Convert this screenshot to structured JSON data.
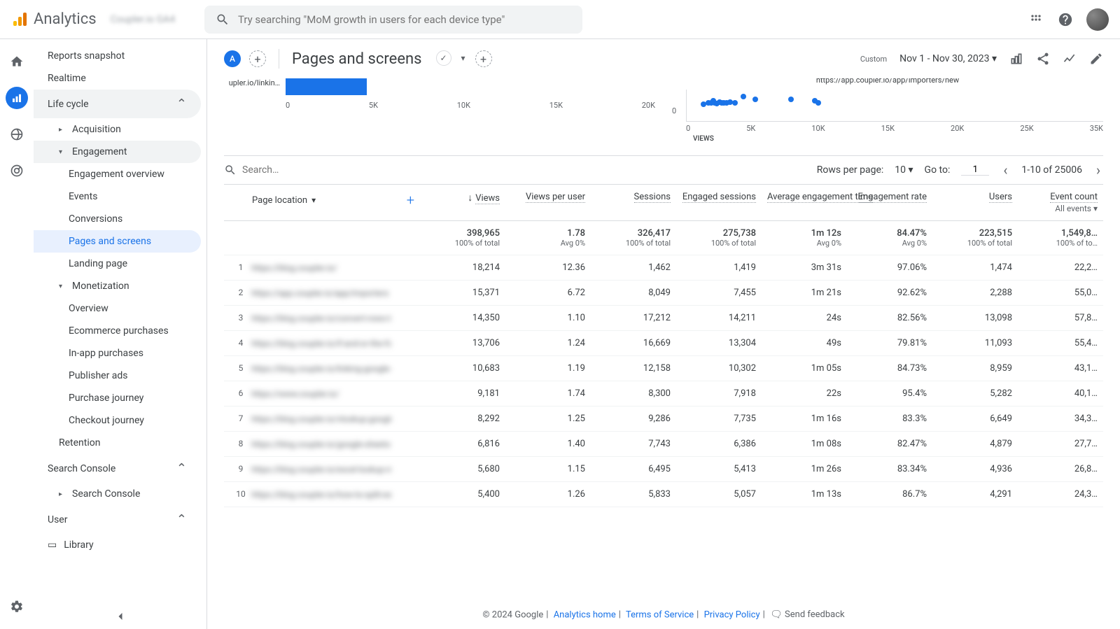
{
  "brand": "Analytics",
  "brand_sub": "Coupler.io GA4",
  "search_placeholder": "Try searching \"MoM growth in users for each device type\"",
  "nav": {
    "reports_snapshot": "Reports snapshot",
    "realtime": "Realtime",
    "life_cycle": "Life cycle",
    "acquisition": "Acquisition",
    "engagement": "Engagement",
    "engagement_overview": "Engagement overview",
    "events": "Events",
    "conversions": "Conversions",
    "pages_screens": "Pages and screens",
    "landing_page": "Landing page",
    "monetization": "Monetization",
    "mon_overview": "Overview",
    "ecommerce": "Ecommerce purchases",
    "inapp": "In-app purchases",
    "publisher": "Publisher ads",
    "purchase_journey": "Purchase journey",
    "checkout_journey": "Checkout journey",
    "retention": "Retention",
    "search_console": "Search Console",
    "search_console_sub": "Search Console",
    "user": "User",
    "library": "Library"
  },
  "page": {
    "badge": "A",
    "title": "Pages and screens",
    "date_label": "Custom",
    "date_range": "Nov 1 - Nov 30, 2023"
  },
  "chart_data": [
    {
      "type": "bar",
      "orientation": "horizontal",
      "categories": [
        "upler.io/linkin…"
      ],
      "values": [
        4400
      ],
      "xlim": [
        0,
        20000
      ],
      "xticks": [
        "0",
        "5K",
        "10K",
        "15K",
        "20K"
      ]
    },
    {
      "type": "scatter",
      "title": "https://app.coupler.io/app/importers/new",
      "xlim": [
        0,
        35000
      ],
      "ylim": [
        0,
        1
      ],
      "xlabel": "VIEWS",
      "xticks": [
        "0",
        "5K",
        "10K",
        "15K",
        "20K",
        "25K",
        "35K"
      ],
      "points": [
        {
          "x": 1200,
          "y": 0.45
        },
        {
          "x": 1600,
          "y": 0.5
        },
        {
          "x": 1800,
          "y": 0.48
        },
        {
          "x": 2000,
          "y": 0.55
        },
        {
          "x": 2100,
          "y": 0.5
        },
        {
          "x": 2300,
          "y": 0.46
        },
        {
          "x": 2500,
          "y": 0.52
        },
        {
          "x": 2700,
          "y": 0.5
        },
        {
          "x": 2900,
          "y": 0.48
        },
        {
          "x": 3100,
          "y": 0.5
        },
        {
          "x": 3400,
          "y": 0.52
        },
        {
          "x": 3800,
          "y": 0.5
        },
        {
          "x": 4500,
          "y": 0.7
        },
        {
          "x": 5500,
          "y": 0.6
        },
        {
          "x": 8500,
          "y": 0.6
        },
        {
          "x": 10500,
          "y": 0.55
        },
        {
          "x": 10800,
          "y": 0.5
        }
      ]
    }
  ],
  "table_controls": {
    "search_placeholder": "Search…",
    "rows_per_page_label": "Rows per page:",
    "rows_per_page_value": "10",
    "goto_label": "Go to:",
    "goto_value": "1",
    "range": "1-10 of 25006"
  },
  "table": {
    "dimension": "Page location",
    "columns": [
      "Views",
      "Views per user",
      "Sessions",
      "Engaged sessions",
      "Average engagement time",
      "Engagement rate",
      "Users",
      "Event count"
    ],
    "event_sub": "All events",
    "totals": {
      "values": [
        "398,965",
        "1.78",
        "326,417",
        "275,738",
        "1m 12s",
        "84.47%",
        "223,515",
        "1,549,8…"
      ],
      "subs": [
        "100% of total",
        "Avg 0%",
        "100% of total",
        "100% of total",
        "Avg 0%",
        "Avg 0%",
        "100% of total",
        "100% of to…"
      ]
    },
    "rows": [
      {
        "idx": "1",
        "loc": "https://blog.coupler.io/",
        "v": [
          "18,214",
          "12.36",
          "1,462",
          "1,419",
          "3m 31s",
          "97.06%",
          "1,474",
          "22,2…"
        ]
      },
      {
        "idx": "2",
        "loc": "https://app.coupler.io/app/importers",
        "v": [
          "15,371",
          "6.72",
          "8,049",
          "7,455",
          "1m 21s",
          "92.62%",
          "2,288",
          "55,0…"
        ]
      },
      {
        "idx": "3",
        "loc": "https://blog.coupler.io/convert-rows-to-columns-excel/",
        "v": [
          "14,350",
          "1.10",
          "17,212",
          "14,211",
          "24s",
          "82.56%",
          "13,098",
          "57,8…"
        ]
      },
      {
        "idx": "4",
        "loc": "https://blog.coupler.io/if-and-or-the-formulas/",
        "v": [
          "13,706",
          "1.24",
          "16,669",
          "13,304",
          "49s",
          "79.81%",
          "11,093",
          "55,4…"
        ]
      },
      {
        "idx": "5",
        "loc": "https://blog.coupler.io/linking-google-sheets/",
        "v": [
          "10,683",
          "1.19",
          "12,158",
          "10,302",
          "1m 05s",
          "84.73%",
          "8,959",
          "43,1…"
        ]
      },
      {
        "idx": "6",
        "loc": "https://www.coupler.io/",
        "v": [
          "9,181",
          "1.74",
          "8,300",
          "7,918",
          "22s",
          "95.4%",
          "5,282",
          "40,1…"
        ]
      },
      {
        "idx": "7",
        "loc": "https://blog.coupler.io/vlookup-google-sheets/",
        "v": [
          "8,292",
          "1.25",
          "9,286",
          "7,735",
          "1m 16s",
          "83.3%",
          "6,649",
          "34,3…"
        ]
      },
      {
        "idx": "8",
        "loc": "https://blog.coupler.io/google-sheets-query-function/",
        "v": [
          "6,816",
          "1.40",
          "7,743",
          "6,386",
          "1m 08s",
          "82.47%",
          "4,879",
          "27,7…"
        ]
      },
      {
        "idx": "9",
        "loc": "https://blog.coupler.io/excel-lookup-multiple-columns/",
        "v": [
          "5,680",
          "1.15",
          "6,495",
          "5,413",
          "1m 26s",
          "83.34%",
          "4,936",
          "26,8…"
        ]
      },
      {
        "idx": "10",
        "loc": "https://blog.coupler.io/how-to-split-excel-sheet-into-multiple-worksheets/",
        "v": [
          "5,400",
          "1.26",
          "5,833",
          "5,057",
          "1m 13s",
          "86.7%",
          "4,291",
          "24,3…"
        ]
      }
    ]
  },
  "footer": {
    "copyright": "© 2024 Google",
    "analytics_home": "Analytics home",
    "terms": "Terms of Service",
    "privacy": "Privacy Policy",
    "feedback": "Send feedback"
  }
}
